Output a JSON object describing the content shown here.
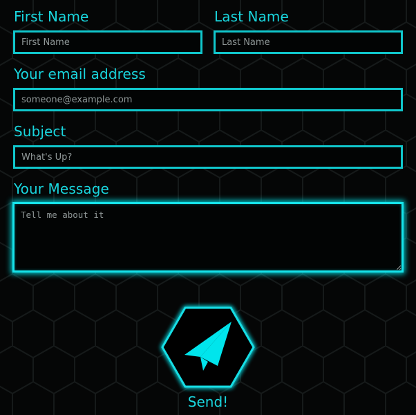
{
  "form": {
    "first_name": {
      "label": "First Name",
      "placeholder": "First Name"
    },
    "last_name": {
      "label": "Last Name",
      "placeholder": "Last Name"
    },
    "email": {
      "label": "Your email address",
      "placeholder": "someone@example.com"
    },
    "subject": {
      "label": "Subject",
      "placeholder": "What's Up?"
    },
    "message": {
      "label": "Your Message",
      "placeholder": "Tell me about it"
    },
    "send": {
      "label": "Send!",
      "icon": "paper-plane-icon"
    }
  },
  "colors": {
    "accent": "#19d6de",
    "field_border": "#10c7cc",
    "glow": "#00eef5",
    "background": "#050606",
    "hex_grid": "#161a1a"
  }
}
